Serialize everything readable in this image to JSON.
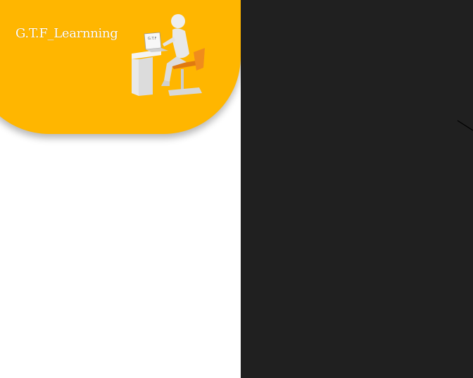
{
  "brand": {
    "title": "G.T.F_Learnning",
    "logo_icon": "person-at-laptop-desk-icon",
    "laptop_text": "G.T.F"
  },
  "colors": {
    "header_bg": "#ffb600",
    "left_panel_bg": "#ffffff",
    "right_panel_bg": "#202020"
  }
}
